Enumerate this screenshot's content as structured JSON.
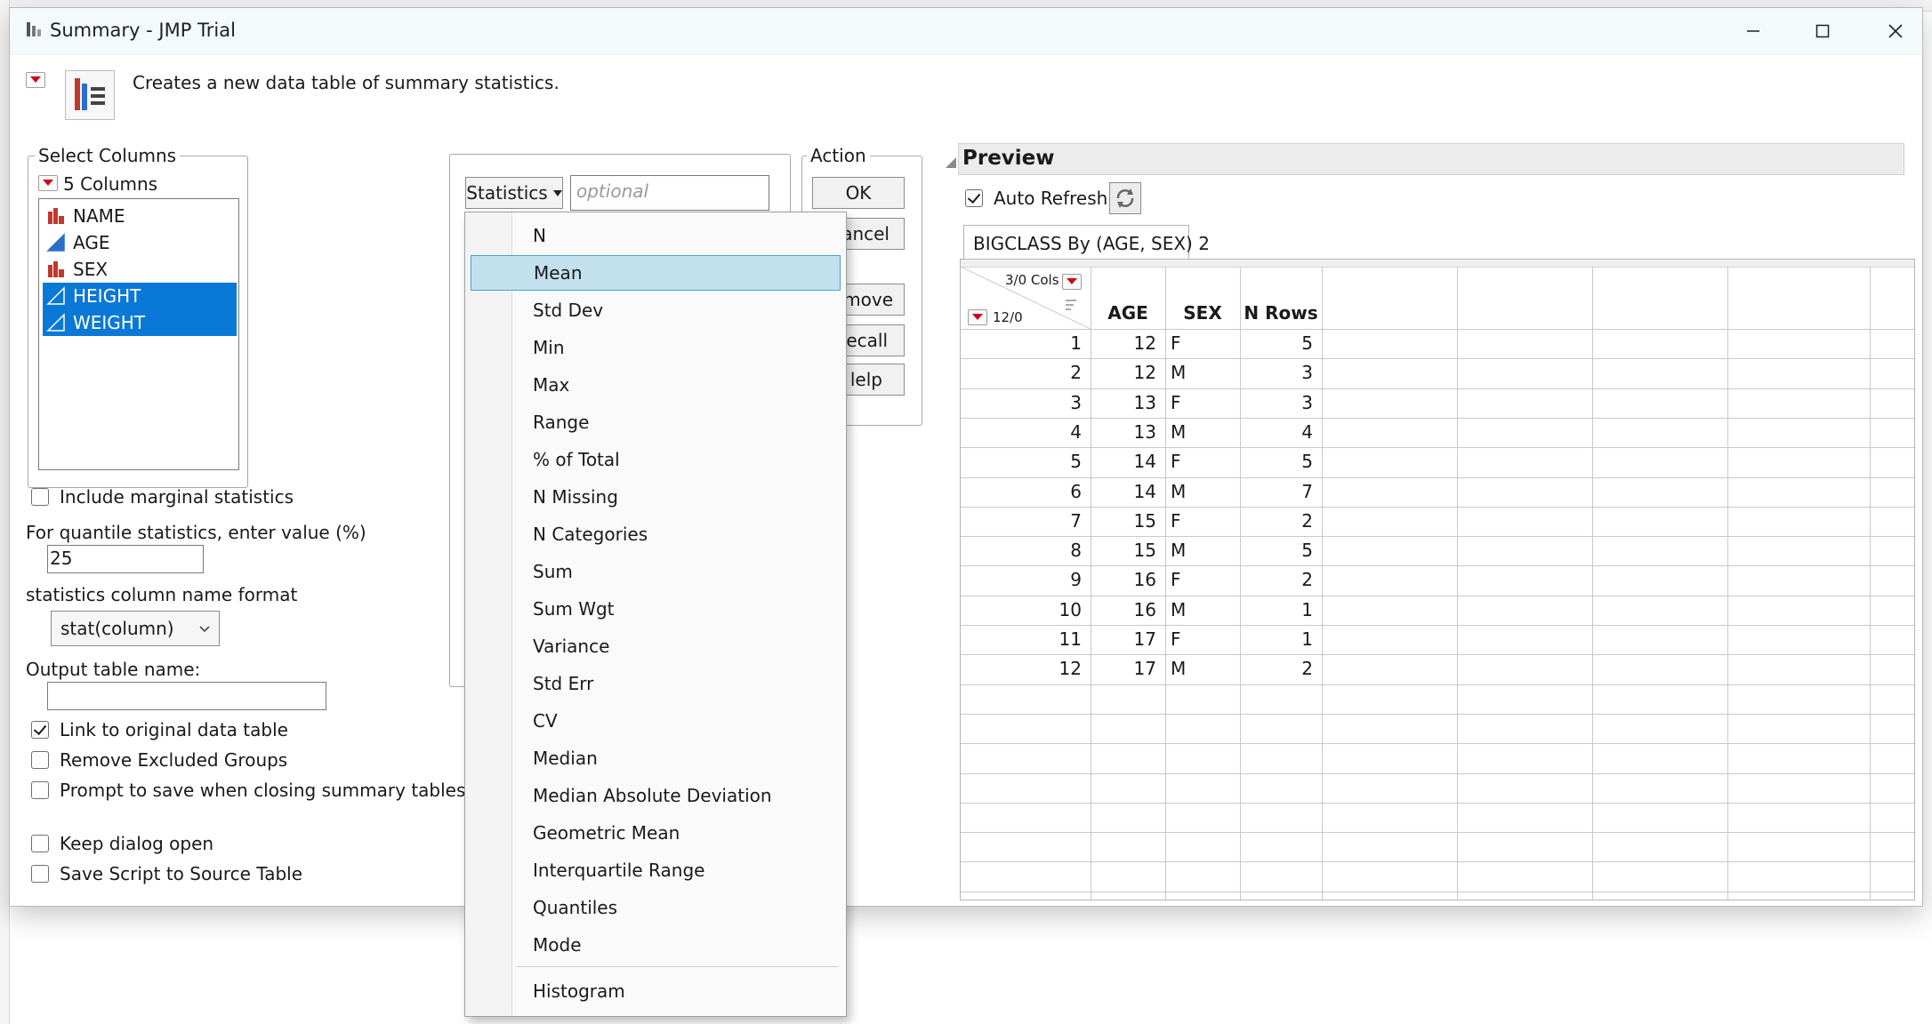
{
  "window": {
    "title": "Summary - JMP Trial",
    "description": "Creates a new data table of summary statistics."
  },
  "select_columns": {
    "label": "Select Columns",
    "count_label": "5 Columns",
    "items": [
      {
        "name": "NAME",
        "type": "nominal",
        "selected": false
      },
      {
        "name": "AGE",
        "type": "continuous",
        "selected": false
      },
      {
        "name": "SEX",
        "type": "nominal",
        "selected": false
      },
      {
        "name": "HEIGHT",
        "type": "continuous",
        "selected": true
      },
      {
        "name": "WEIGHT",
        "type": "continuous",
        "selected": true
      }
    ]
  },
  "options": {
    "include_marginal": "Include marginal statistics",
    "quantile_label": "For quantile statistics, enter value (%)",
    "quantile_value": "25",
    "colname_format_label": "statistics column name format",
    "colname_format_value": "stat(column)",
    "output_name_label": "Output table name:",
    "output_name_value": "",
    "link_original": "Link to original data table",
    "remove_excluded": "Remove Excluded Groups",
    "prompt_save": "Prompt to save when closing summary tables",
    "keep_open": "Keep dialog open",
    "save_script": "Save Script to Source Table"
  },
  "statistics": {
    "button_label": "Statistics",
    "optional_placeholder": "optional"
  },
  "menu": {
    "items": [
      "N",
      "Mean",
      "Std Dev",
      "Min",
      "Max",
      "Range",
      "% of Total",
      "N Missing",
      "N Categories",
      "Sum",
      "Sum Wgt",
      "Variance",
      "Std Err",
      "CV",
      "Median",
      "Median Absolute Deviation",
      "Geometric Mean",
      "Interquartile Range",
      "Quantiles",
      "Mode"
    ],
    "highlighted": "Mean",
    "after_separator": "Histogram"
  },
  "action": {
    "label": "Action",
    "ok": "OK",
    "cancel_partial": "ancel",
    "remove_partial": "move",
    "recall_partial": "ecall",
    "help_partial": "lelp"
  },
  "preview": {
    "title": "Preview",
    "auto_refresh": "Auto Refresh",
    "tab": "BIGCLASS By (AGE, SEX) 2",
    "cols_info": "3/0 Cols",
    "rows_info": "12/0",
    "headers": [
      "AGE",
      "SEX",
      "N Rows"
    ],
    "rows": [
      {
        "n": "1",
        "age": "12",
        "sex": "F",
        "nrows": "5"
      },
      {
        "n": "2",
        "age": "12",
        "sex": "M",
        "nrows": "3"
      },
      {
        "n": "3",
        "age": "13",
        "sex": "F",
        "nrows": "3"
      },
      {
        "n": "4",
        "age": "13",
        "sex": "M",
        "nrows": "4"
      },
      {
        "n": "5",
        "age": "14",
        "sex": "F",
        "nrows": "5"
      },
      {
        "n": "6",
        "age": "14",
        "sex": "M",
        "nrows": "7"
      },
      {
        "n": "7",
        "age": "15",
        "sex": "F",
        "nrows": "2"
      },
      {
        "n": "8",
        "age": "15",
        "sex": "M",
        "nrows": "5"
      },
      {
        "n": "9",
        "age": "16",
        "sex": "F",
        "nrows": "2"
      },
      {
        "n": "10",
        "age": "16",
        "sex": "M",
        "nrows": "1"
      },
      {
        "n": "11",
        "age": "17",
        "sex": "F",
        "nrows": "1"
      },
      {
        "n": "12",
        "age": "17",
        "sex": "M",
        "nrows": "2"
      }
    ]
  },
  "colors": {
    "selection": "#0a78d7",
    "menu_highlight": "#c3e0ef",
    "disclosure_red": "#d0021b",
    "continuous_blue": "#2a6fc9",
    "nominal_red": "#c0392b"
  }
}
